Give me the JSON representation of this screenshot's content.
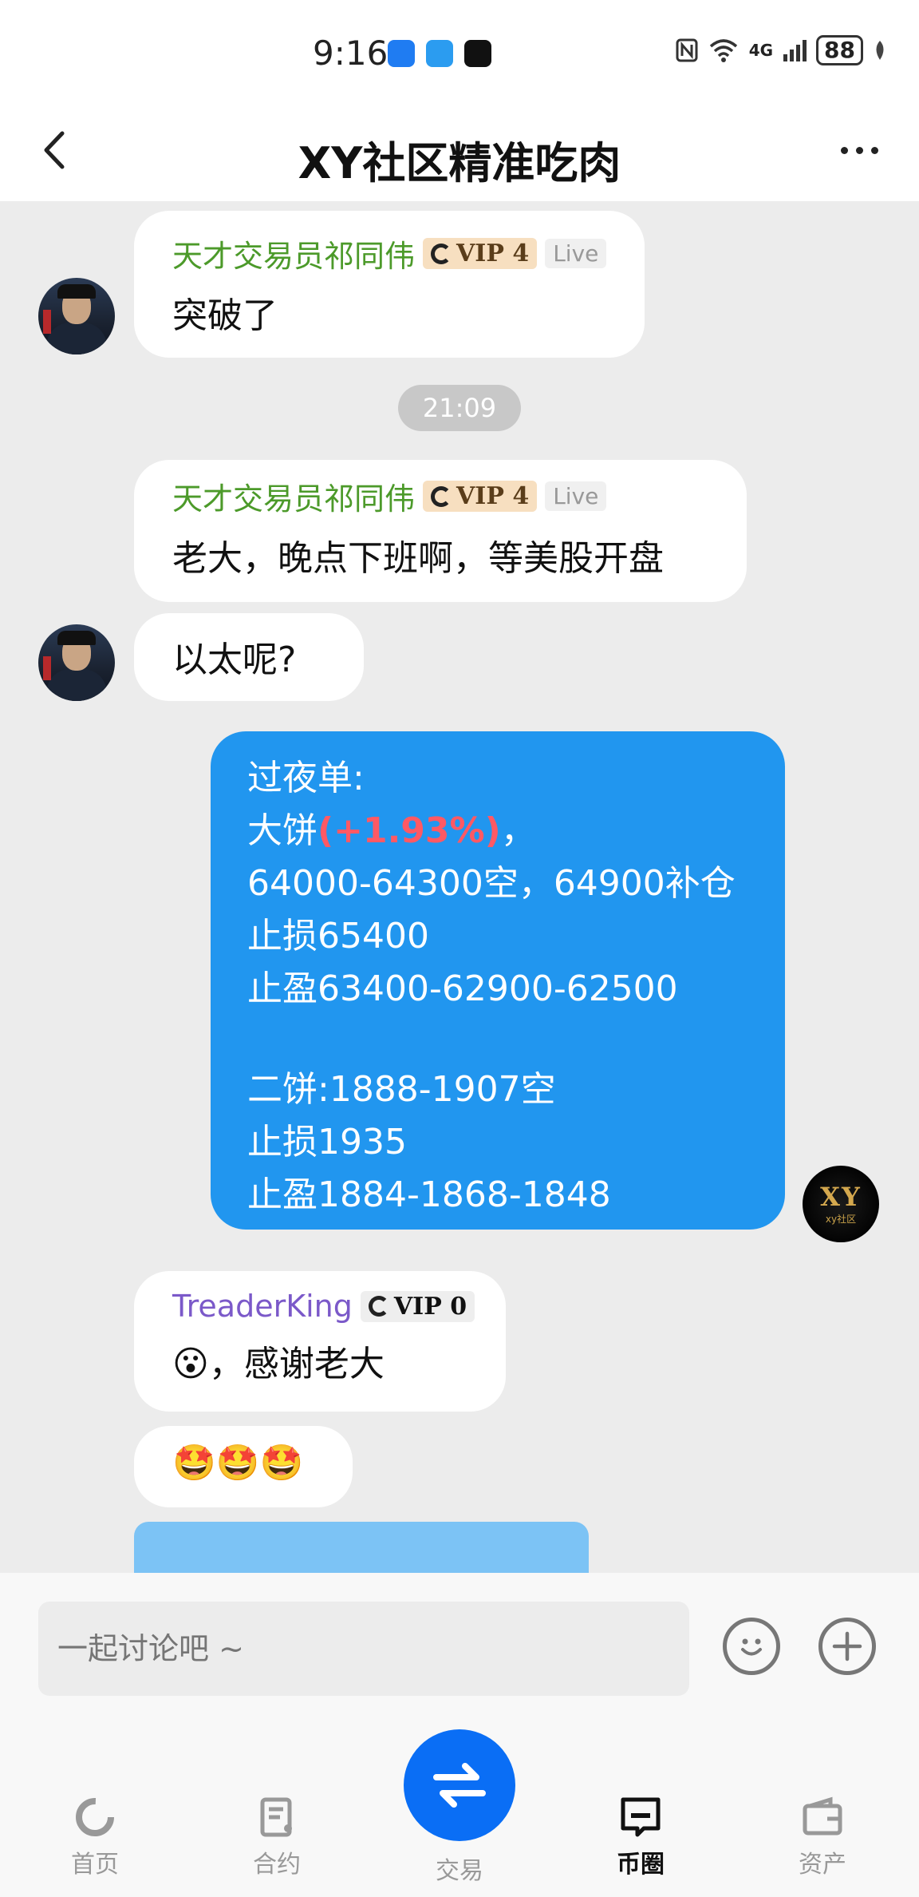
{
  "status_bar": {
    "time": "9:16",
    "battery": "88",
    "network": "4G"
  },
  "header": {
    "title": "XY社区精准吃肉"
  },
  "messages": [
    {
      "sender": "天才交易员祁同伟",
      "vip": "VIP 4",
      "live": "Live",
      "text": "突破了"
    },
    {
      "time": "21:09"
    },
    {
      "sender": "天才交易员祁同伟",
      "vip": "VIP 4",
      "live": "Live",
      "text": "老大，晚点下班啊，等美股开盘"
    },
    {
      "text": "以太呢?"
    },
    {
      "lines": [
        "过夜单:",
        "大饼",
        "(+1.93%)",
        "，",
        "64000-64300空，64900补仓",
        "止损65400",
        "止盈63400-62900-62500",
        "二饼:1888-1907空",
        "止损1935",
        "止盈1884-1868-1848"
      ]
    },
    {
      "sender": "TreaderKing",
      "vip": "VIP 0",
      "text_emoji": "😮",
      "text": "，感谢老大"
    },
    {
      "emojis": "🤩🤩🤩"
    }
  ],
  "own_avatar": {
    "big": "XY",
    "small": "xy社区"
  },
  "input": {
    "placeholder": "一起讨论吧 ~"
  },
  "nav": {
    "home": "首页",
    "contract": "合约",
    "trade": "交易",
    "circle": "币圈",
    "assets": "资产"
  }
}
